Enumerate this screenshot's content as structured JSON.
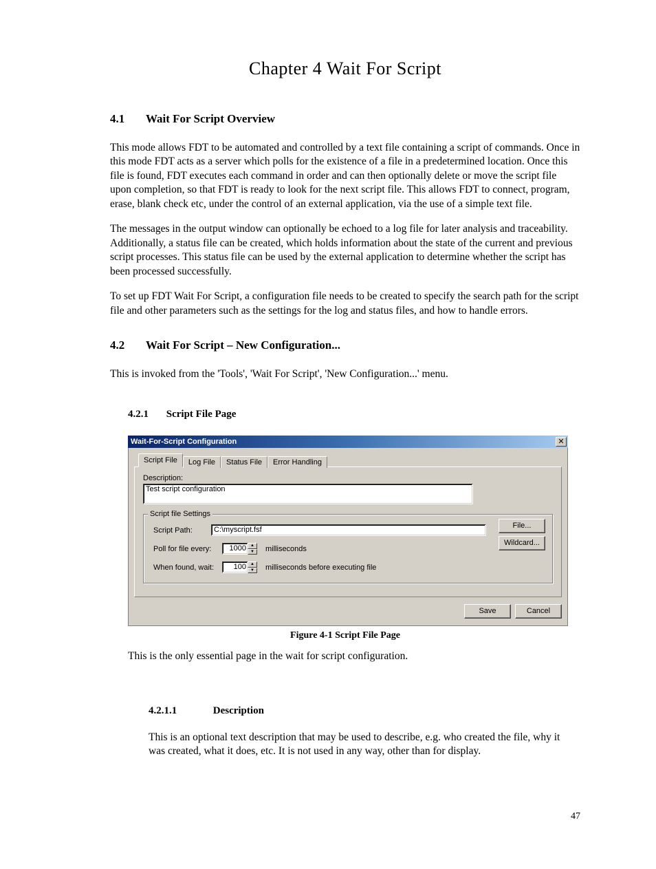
{
  "chapter_title": "Chapter 4   Wait For Script",
  "section_41": {
    "number": "4.1",
    "title": "Wait For Script Overview",
    "p1": "This mode allows FDT to be automated and controlled by a text file containing a script of commands. Once in this mode FDT acts as a server which polls for the existence of a file in a predetermined location. Once this file is found, FDT executes each command in order and can then optionally delete or move the script file upon completion, so that FDT is ready to look for the next script file. This allows FDT to connect, program, erase, blank check etc, under the control of an external application, via the use of a simple text file.",
    "p2": "The messages in the output window can optionally be echoed to a log file for later analysis and traceability. Additionally, a status file can be created, which holds information about the state of the current and previous script processes. This status file can be used by the external application to determine whether the script has been processed successfully.",
    "p3": "To set up FDT Wait For Script, a configuration file needs to be created to specify the search path for the script file and other parameters such as the settings for the log and status files, and how to handle errors."
  },
  "section_42": {
    "number": "4.2",
    "title": "Wait For Script – New Configuration...",
    "p1": "This is invoked from the 'Tools', 'Wait For Script', 'New Configuration...' menu."
  },
  "sub_421": {
    "number": "4.2.1",
    "title": "Script File Page"
  },
  "dialog": {
    "title": "Wait-For-Script Configuration",
    "tabs": [
      "Script File",
      "Log File",
      "Status File",
      "Error Handling"
    ],
    "desc_label": "Description:",
    "desc_value": "Test script configuration",
    "groupbox_title": "Script file Settings",
    "script_path_label": "Script Path:",
    "script_path_value": "C:\\myscript.fsf",
    "poll_label": "Poll for file every:",
    "poll_value": "1000",
    "poll_suffix": "milliseconds",
    "wait_label": "When found, wait:",
    "wait_value": "100",
    "wait_suffix": "milliseconds before executing file",
    "file_button": "File...",
    "wildcard_button": "Wildcard...",
    "save_button": "Save",
    "cancel_button": "Cancel"
  },
  "figure_caption": "Figure 4-1 Script File Page",
  "after_figure": "This is the only essential page in the wait for script configuration.",
  "sub_4211": {
    "number": "4.2.1.1",
    "title": "Description",
    "p": "This is an optional text description that may be used to describe, e.g. who created the file, why it was created, what it does, etc. It is not used in any way, other than for display."
  },
  "page_number": "47"
}
